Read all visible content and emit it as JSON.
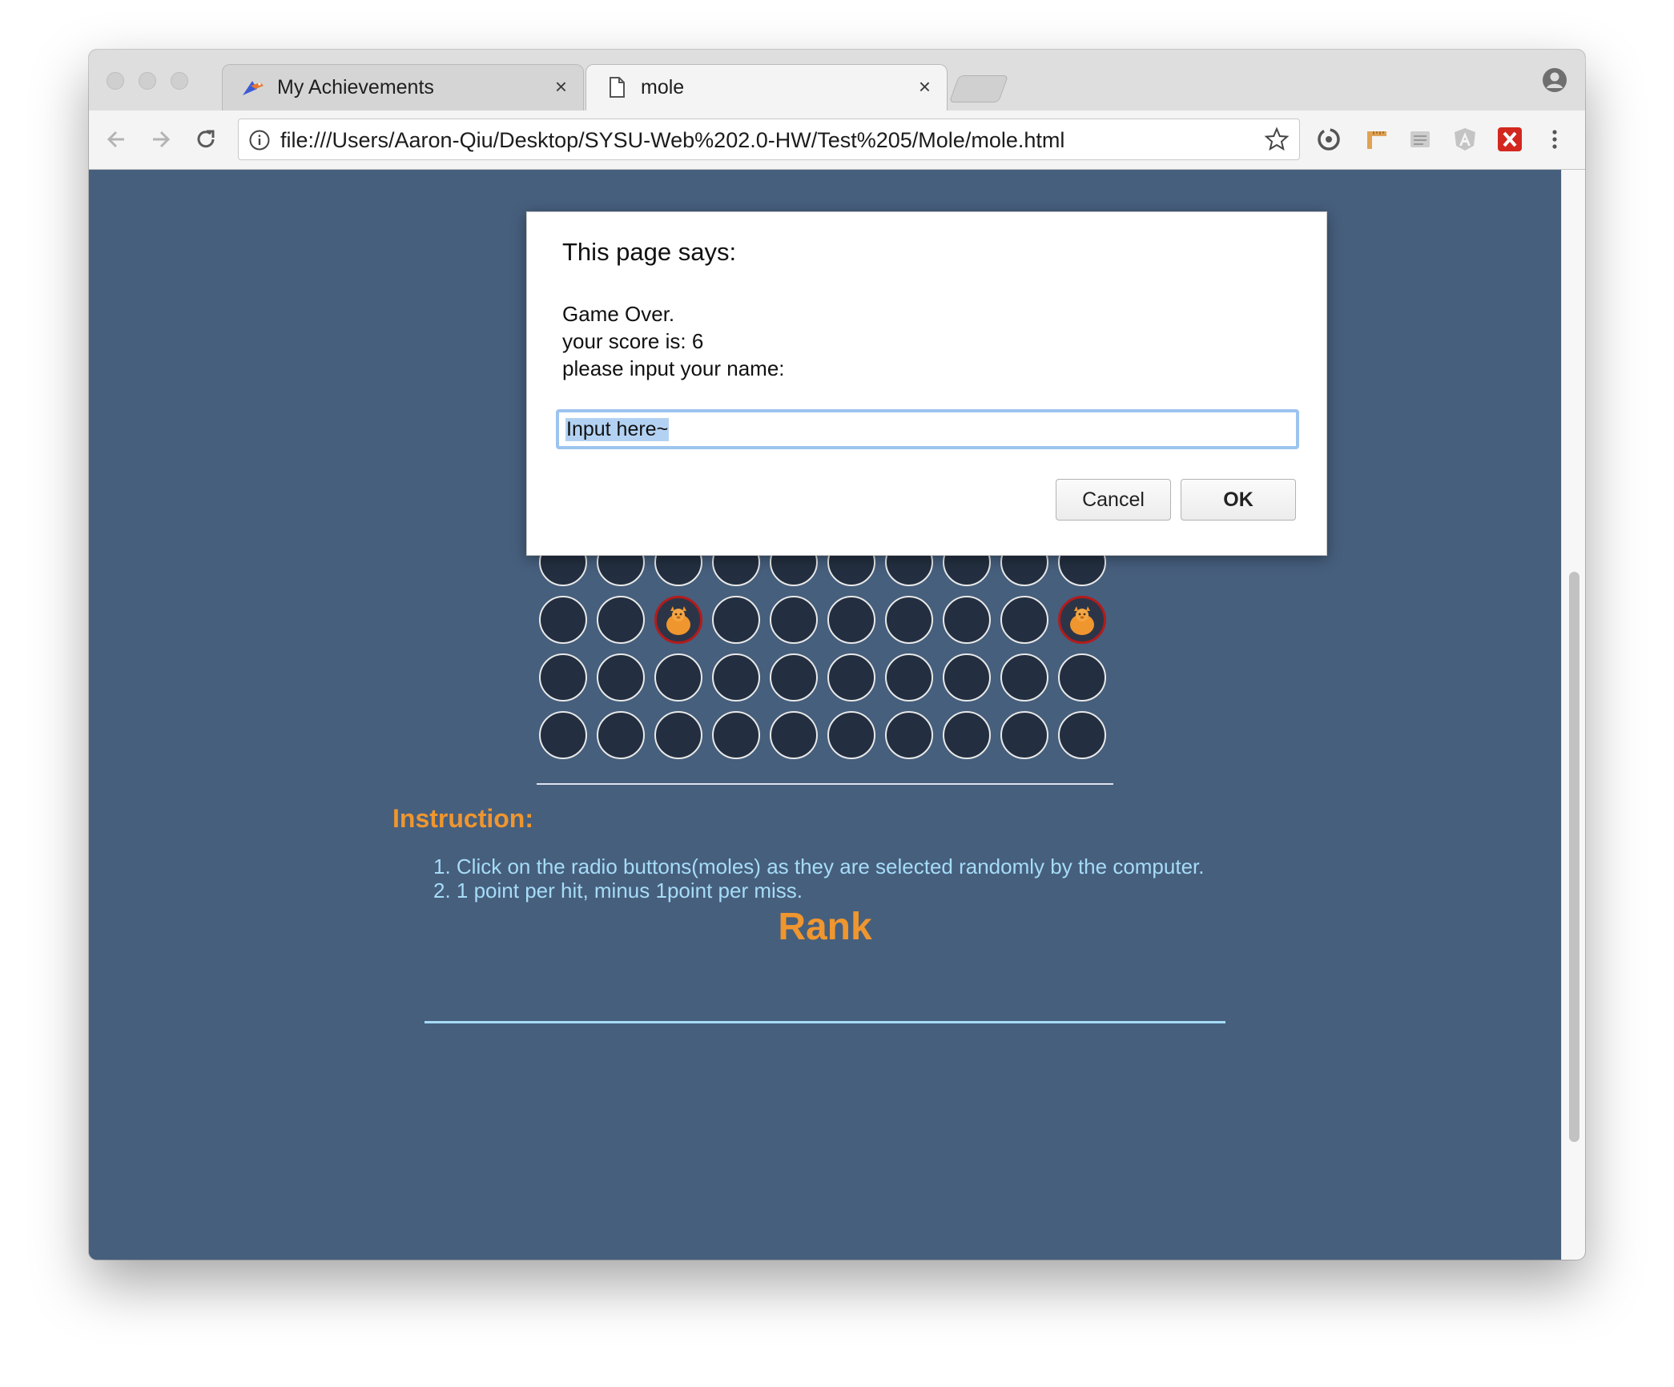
{
  "browser": {
    "tabs": [
      {
        "title": "My Achievements",
        "active": false,
        "icon": "bird-logo-icon"
      },
      {
        "title": "mole",
        "active": true,
        "icon": "document-icon"
      }
    ],
    "tab_close_glyph": "×",
    "url": "file:///Users/Aaron-Qiu/Desktop/SYSU-Web%202.0-HW/Test%205/Mole/mole.html"
  },
  "dialog": {
    "title": "This page says:",
    "message_lines": [
      "Game Over.",
      "your score is: 6",
      "please input your name:"
    ],
    "input_value": "Input here~",
    "cancel_label": "Cancel",
    "ok_label": "OK"
  },
  "page": {
    "instruction_title": "Instruction:",
    "instructions": [
      "1. Click on the radio buttons(moles) as they are selected randomly by the computer.",
      "2. 1 point per hit, minus 1point per miss."
    ],
    "rank_title": "Rank"
  },
  "board": {
    "columns": 10,
    "visible_rows": 4,
    "mole_positions": [
      [
        1,
        2
      ],
      [
        1,
        9
      ]
    ]
  },
  "colors": {
    "page_background": "#465f7d",
    "accent_orange": "#f0962e",
    "light_blue_text": "#a6dcf8",
    "hole_fill": "#232f40",
    "mole_ring": "#b31b1b"
  }
}
